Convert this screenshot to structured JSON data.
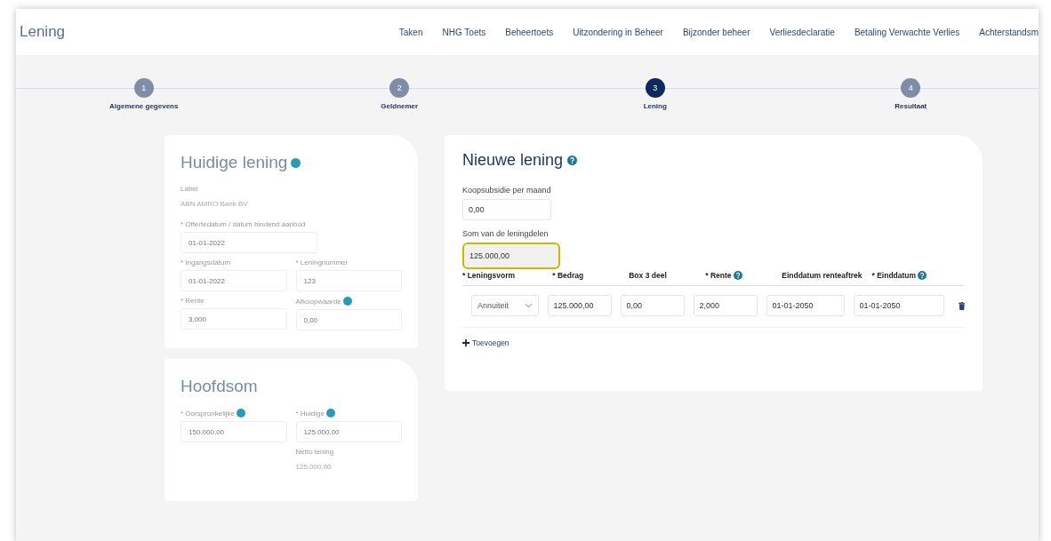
{
  "app": {
    "title": "Lening"
  },
  "nav": [
    "Taken",
    "NHG Toets",
    "Beheertoets",
    "Uitzondering in Beheer",
    "Bijzonder beheer",
    "Verliesdeclaratie",
    "Betaling Verwachte Verlies",
    "Achterstandsm"
  ],
  "steps": [
    {
      "number": "1",
      "label": "Algemene gegevens",
      "selected": false
    },
    {
      "number": "2",
      "label": "Geldnemer",
      "selected": false
    },
    {
      "number": "3",
      "label": "Lening",
      "selected": true
    },
    {
      "number": "4",
      "label": "Resultaat",
      "selected": false
    }
  ],
  "current_loan": {
    "title": "Huidige lening",
    "lender_label": "Label",
    "lender": "ABN AMRO Bank BV",
    "fields": [
      {
        "label": "* Offertedatum / datum bindend aanbod",
        "value": "01-01-2022",
        "help": false,
        "wide": true
      },
      {
        "label": "* Ingangsdatum",
        "value": "01-01-2022",
        "help": false,
        "wide": false
      },
      {
        "label": "* Leningnummer",
        "value": "123",
        "help": false,
        "wide": false
      },
      {
        "label": "* Rente",
        "value": "3,000",
        "help": false,
        "wide": false
      },
      {
        "label": "Afkoopwaarde",
        "value": "0,00",
        "help": true,
        "wide": false
      }
    ]
  },
  "principal": {
    "title": "Hoofdsom",
    "fields": [
      {
        "label": "* Oorspronkelijke",
        "value": "150.000,00",
        "help": true
      },
      {
        "label": "* Huidige",
        "value": "125.000,00",
        "help": true
      }
    ],
    "net_label": "Netto lening",
    "net_value": "125.000,00"
  },
  "new_loan": {
    "title": "Nieuwe lening",
    "fields": [
      {
        "label": "Koopsubsidie per maand",
        "value": "0,00",
        "readonly": false,
        "highlighted": false
      },
      {
        "label": "Som van de leningdelen",
        "value": "125.000,00",
        "readonly": true,
        "highlighted": true
      }
    ],
    "columns": [
      {
        "label": "* Leningsvorm",
        "help": false
      },
      {
        "label": "* Bedrag",
        "help": false
      },
      {
        "label": "Box 3 deel",
        "help": false
      },
      {
        "label": "* Rente",
        "help": true
      },
      {
        "label": "Einddatum renteaftrek",
        "help": false
      },
      {
        "label": "* Einddatum",
        "help": true
      }
    ],
    "rows": [
      [
        {
          "kind": "select",
          "value": "Annuiteit"
        },
        {
          "kind": "input",
          "value": "125.000,00"
        },
        {
          "kind": "input",
          "value": "0,00"
        },
        {
          "kind": "input",
          "value": "2,000"
        },
        {
          "kind": "input",
          "value": "01-01-2050"
        },
        {
          "kind": "input",
          "value": "01-01-2050"
        }
      ]
    ],
    "add_label": "Toevoegen"
  }
}
